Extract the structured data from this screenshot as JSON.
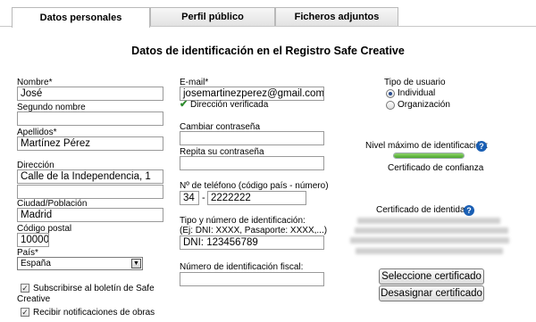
{
  "tabs": [
    {
      "label": "Datos personales",
      "active": true
    },
    {
      "label": "Perfil público",
      "active": false
    },
    {
      "label": "Ficheros adjuntos",
      "active": false
    }
  ],
  "title": "Datos de identificación en el Registro Safe Creative",
  "left": {
    "nombre_label": "Nombre*",
    "nombre_value": "José",
    "segundo_label": "Segundo nombre",
    "segundo_value": "",
    "apellidos_label": "Apellidos*",
    "apellidos_value": "Martínez Pérez",
    "direccion_label": "Dirección",
    "direccion_value": "Calle de la Independencia, 1",
    "direccion2_value": "",
    "ciudad_label": "Ciudad/Población",
    "ciudad_value": "Madrid",
    "cp_label": "Código postal",
    "cp_value": "10000",
    "pais_label": "País*",
    "pais_value": "España",
    "boletin_label": "Subscribirse al boletín de Safe Creative",
    "boletin_checked": true,
    "notif_label": "Recibir notificaciones de obras",
    "notif_checked": true
  },
  "middle": {
    "email_label": "E-mail*",
    "email_value": "josemartinezperez@gmail.com",
    "verified_text": "Dirección verificada",
    "pass_label": "Cambiar contraseña",
    "pass_value": "",
    "repass_label": "Repita su contraseña",
    "repass_value": "",
    "phone_label": "Nº de teléfono (código país - número)",
    "phone_country": "34",
    "phone_sep": "-",
    "phone_number": "2222222",
    "id_label": "Tipo y número de identificación:",
    "id_hint": "(Ej: DNI: XXXX, Pasaporte: XXXX,...)",
    "id_value": "DNI: 123456789",
    "fiscal_label": "Número de identificación fiscal:",
    "fiscal_value": ""
  },
  "right": {
    "user_type_label": "Tipo de usuario",
    "opt_individual": "Individual",
    "opt_org": "Organización",
    "selected": "Individual",
    "level_label": "Nivel máximo de identificación:",
    "level_progress": 1.0,
    "level_text": "Certificado de confianza",
    "cert_label": "Certificado de identidad",
    "btn_select": "Seleccione certificado",
    "btn_unassign": "Desasignar certificado"
  },
  "icons": {
    "help": "help-icon",
    "check": "check-icon",
    "dropdown": "dropdown-arrow-icon"
  },
  "colors": {
    "help_blue": "#1a5fb4",
    "verified_green": "#2e8b2e",
    "progress_green": "#4aa52e"
  }
}
